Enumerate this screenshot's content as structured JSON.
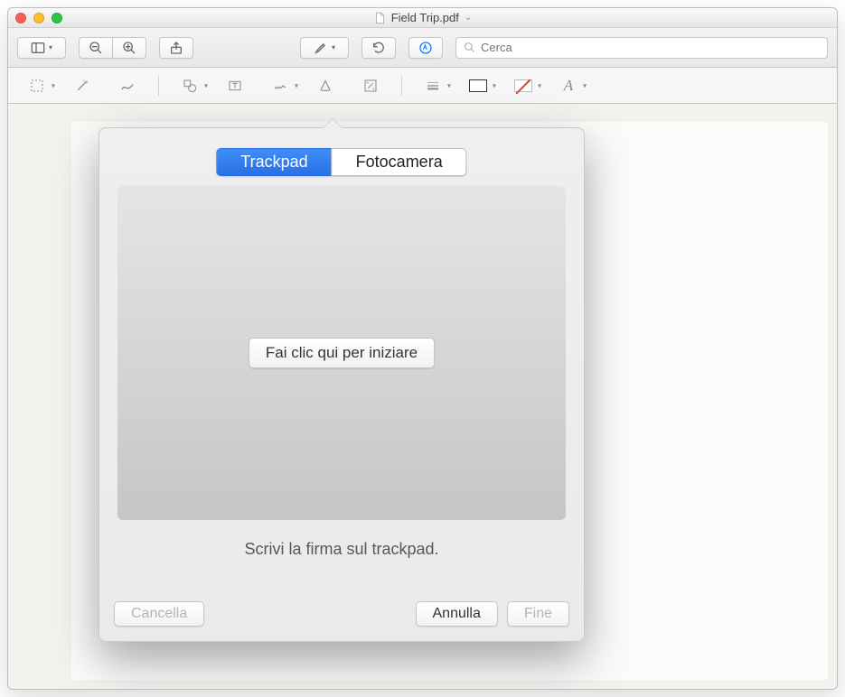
{
  "window": {
    "title": "Field Trip.pdf"
  },
  "toolbar1": {
    "search_placeholder": "Cerca"
  },
  "icons": {
    "sidebar": "sidebar-icon",
    "zoom_out": "zoom-out-icon",
    "zoom_in": "zoom-in-icon",
    "share": "share-icon",
    "highlight": "highlight-icon",
    "rotate": "rotate-icon",
    "markup": "markup-icon",
    "search": "search-icon"
  },
  "markup_toolbar": {
    "selection": "selection-icon",
    "instant_alpha": "wand-icon",
    "sketch": "sketch-icon",
    "shapes": "shapes-icon",
    "text": "text-icon",
    "sign": "signature-icon",
    "annotate": "note-icon",
    "adjust": "adjust-icon",
    "line": "line-style-icon",
    "stroke": "stroke-color-icon",
    "fill": "fill-color-icon",
    "font": "font-style-icon"
  },
  "popover": {
    "tabs": {
      "trackpad": "Trackpad",
      "camera": "Fotocamera"
    },
    "start_button": "Fai clic qui per iniziare",
    "instruction": "Scrivi la firma sul trackpad.",
    "buttons": {
      "clear": "Cancella",
      "cancel": "Annulla",
      "done": "Fine"
    }
  }
}
